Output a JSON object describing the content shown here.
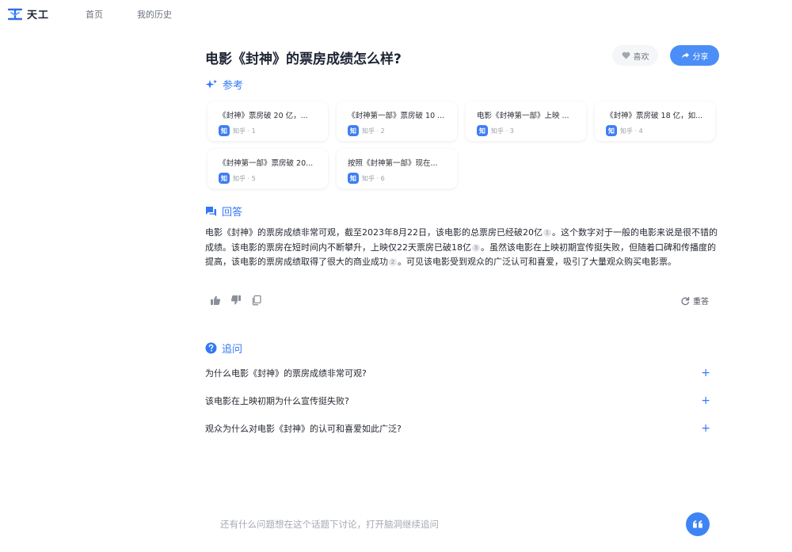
{
  "nav": {
    "logo_text": "天工",
    "home": "首页",
    "history": "我的历史"
  },
  "question": {
    "title": "电影《封神》的票房成绩怎么样?",
    "like_label": "喜欢",
    "share_label": "分享"
  },
  "references": {
    "heading": "参考",
    "items": [
      {
        "title": "《封神》票房破 20 亿，...",
        "source": "知乎 · 1"
      },
      {
        "title": "《封神第一部》票房破 10 ...",
        "source": "知乎 · 2"
      },
      {
        "title": "电影《封神第一部》上映 ...",
        "source": "知乎 · 3"
      },
      {
        "title": "《封神》票房破 18 亿，如...",
        "source": "知乎 · 4"
      },
      {
        "title": "《封神第一部》票房破 20...",
        "source": "知乎 · 5"
      },
      {
        "title": "按照《封神第一部》现在...",
        "source": "知乎 · 6"
      }
    ],
    "badge": "知"
  },
  "answer": {
    "heading": "回答",
    "p1": "电影《封神》的票房成绩非常可观，截至2023年8月22日，该电影的总票房已经破20亿",
    "c1": "1",
    "p2": "。这个数字对于一般的电影来说是很不错的成绩。该电影的票房在短时间内不断攀升，上映仅22天票房已破18亿",
    "c2": "3",
    "p3": "。虽然该电影在上映初期宣传挺失败，但随着口碑和传播度的提高，该电影的票房成绩取得了很大的商业成功",
    "c3": "2",
    "p4": "。可见该电影受到观众的广泛认可和喜爱，吸引了大量观众购买电影票。",
    "regenerate": "重答"
  },
  "followup": {
    "heading": "追问",
    "items": [
      "为什么电影《封神》的票房成绩非常可观?",
      "该电影在上映初期为什么宣传挺失败?",
      "观众为什么对电影《封神》的认可和喜爱如此广泛?"
    ],
    "plus": "+"
  },
  "ask": {
    "placeholder": "还有什么问题想在这个话题下讨论，打开脑洞继续追问"
  },
  "colors": {
    "accent": "#3478f6",
    "share_bg": "#4c8ef7",
    "zhihu_badge": "#3f7df2"
  }
}
